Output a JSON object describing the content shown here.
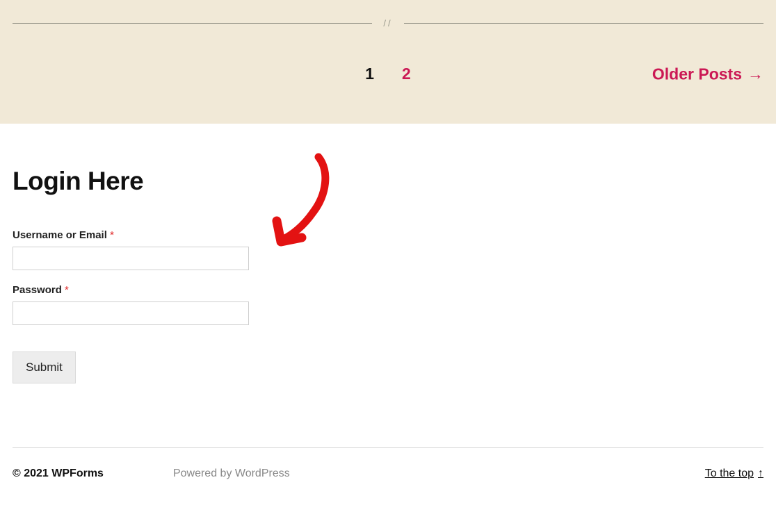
{
  "pagination": {
    "current": "1",
    "next": "2",
    "older_label": "Older Posts"
  },
  "login": {
    "heading": "Login Here",
    "username_label": "Username or Email",
    "password_label": "Password",
    "required_mark": "*",
    "submit_label": "Submit"
  },
  "footer": {
    "copyright": "© 2021 WPForms",
    "powered": "Powered by WordPress",
    "to_top": "To the top"
  }
}
